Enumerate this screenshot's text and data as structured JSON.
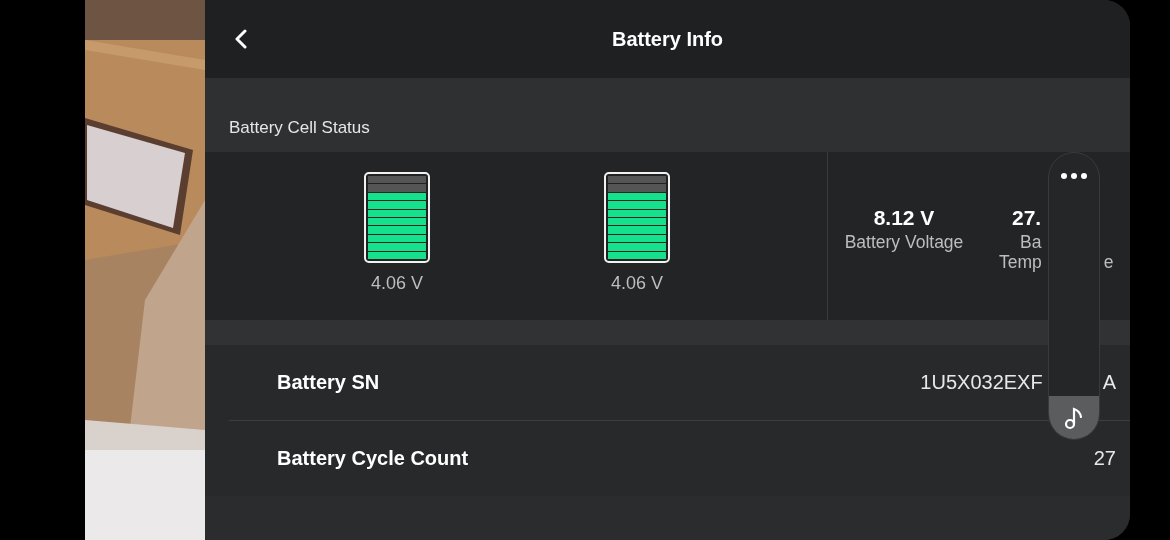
{
  "header": {
    "title": "Battery Info"
  },
  "cell_section": {
    "title": "Battery Cell Status"
  },
  "cells": [
    {
      "level": 0.8,
      "reading": "4.06 V"
    },
    {
      "level": 0.8,
      "reading": "4.06 V"
    }
  ],
  "stats": [
    {
      "value": "8.12 V",
      "label_lines": [
        [
          "Battery Voltage"
        ]
      ]
    },
    {
      "value": "27.",
      "label_lines": [
        [
          "Ba"
        ],
        [
          "Temp",
          "e"
        ]
      ]
    }
  ],
  "rows": [
    {
      "label": "Battery SN",
      "value_parts": [
        "1U5X032EXF",
        "A"
      ]
    },
    {
      "label": "Battery Cycle Count",
      "value_parts": [
        "27"
      ]
    }
  ]
}
